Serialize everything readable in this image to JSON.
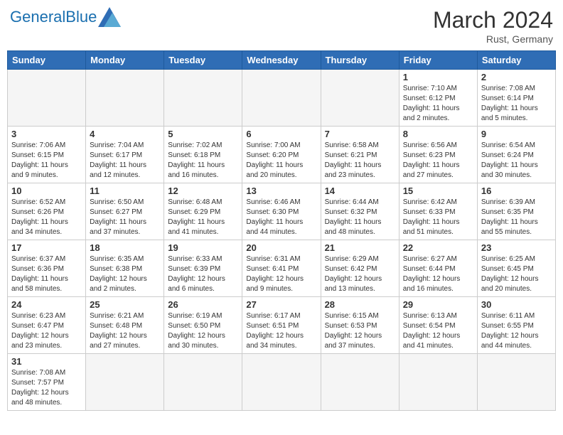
{
  "header": {
    "logo_general": "General",
    "logo_blue": "Blue",
    "month_title": "March 2024",
    "location": "Rust, Germany"
  },
  "weekdays": [
    "Sunday",
    "Monday",
    "Tuesday",
    "Wednesday",
    "Thursday",
    "Friday",
    "Saturday"
  ],
  "weeks": [
    [
      {
        "day": "",
        "info": ""
      },
      {
        "day": "",
        "info": ""
      },
      {
        "day": "",
        "info": ""
      },
      {
        "day": "",
        "info": ""
      },
      {
        "day": "",
        "info": ""
      },
      {
        "day": "1",
        "info": "Sunrise: 7:10 AM\nSunset: 6:12 PM\nDaylight: 11 hours\nand 2 minutes."
      },
      {
        "day": "2",
        "info": "Sunrise: 7:08 AM\nSunset: 6:14 PM\nDaylight: 11 hours\nand 5 minutes."
      }
    ],
    [
      {
        "day": "3",
        "info": "Sunrise: 7:06 AM\nSunset: 6:15 PM\nDaylight: 11 hours\nand 9 minutes."
      },
      {
        "day": "4",
        "info": "Sunrise: 7:04 AM\nSunset: 6:17 PM\nDaylight: 11 hours\nand 12 minutes."
      },
      {
        "day": "5",
        "info": "Sunrise: 7:02 AM\nSunset: 6:18 PM\nDaylight: 11 hours\nand 16 minutes."
      },
      {
        "day": "6",
        "info": "Sunrise: 7:00 AM\nSunset: 6:20 PM\nDaylight: 11 hours\nand 20 minutes."
      },
      {
        "day": "7",
        "info": "Sunrise: 6:58 AM\nSunset: 6:21 PM\nDaylight: 11 hours\nand 23 minutes."
      },
      {
        "day": "8",
        "info": "Sunrise: 6:56 AM\nSunset: 6:23 PM\nDaylight: 11 hours\nand 27 minutes."
      },
      {
        "day": "9",
        "info": "Sunrise: 6:54 AM\nSunset: 6:24 PM\nDaylight: 11 hours\nand 30 minutes."
      }
    ],
    [
      {
        "day": "10",
        "info": "Sunrise: 6:52 AM\nSunset: 6:26 PM\nDaylight: 11 hours\nand 34 minutes."
      },
      {
        "day": "11",
        "info": "Sunrise: 6:50 AM\nSunset: 6:27 PM\nDaylight: 11 hours\nand 37 minutes."
      },
      {
        "day": "12",
        "info": "Sunrise: 6:48 AM\nSunset: 6:29 PM\nDaylight: 11 hours\nand 41 minutes."
      },
      {
        "day": "13",
        "info": "Sunrise: 6:46 AM\nSunset: 6:30 PM\nDaylight: 11 hours\nand 44 minutes."
      },
      {
        "day": "14",
        "info": "Sunrise: 6:44 AM\nSunset: 6:32 PM\nDaylight: 11 hours\nand 48 minutes."
      },
      {
        "day": "15",
        "info": "Sunrise: 6:42 AM\nSunset: 6:33 PM\nDaylight: 11 hours\nand 51 minutes."
      },
      {
        "day": "16",
        "info": "Sunrise: 6:39 AM\nSunset: 6:35 PM\nDaylight: 11 hours\nand 55 minutes."
      }
    ],
    [
      {
        "day": "17",
        "info": "Sunrise: 6:37 AM\nSunset: 6:36 PM\nDaylight: 11 hours\nand 58 minutes."
      },
      {
        "day": "18",
        "info": "Sunrise: 6:35 AM\nSunset: 6:38 PM\nDaylight: 12 hours\nand 2 minutes."
      },
      {
        "day": "19",
        "info": "Sunrise: 6:33 AM\nSunset: 6:39 PM\nDaylight: 12 hours\nand 6 minutes."
      },
      {
        "day": "20",
        "info": "Sunrise: 6:31 AM\nSunset: 6:41 PM\nDaylight: 12 hours\nand 9 minutes."
      },
      {
        "day": "21",
        "info": "Sunrise: 6:29 AM\nSunset: 6:42 PM\nDaylight: 12 hours\nand 13 minutes."
      },
      {
        "day": "22",
        "info": "Sunrise: 6:27 AM\nSunset: 6:44 PM\nDaylight: 12 hours\nand 16 minutes."
      },
      {
        "day": "23",
        "info": "Sunrise: 6:25 AM\nSunset: 6:45 PM\nDaylight: 12 hours\nand 20 minutes."
      }
    ],
    [
      {
        "day": "24",
        "info": "Sunrise: 6:23 AM\nSunset: 6:47 PM\nDaylight: 12 hours\nand 23 minutes."
      },
      {
        "day": "25",
        "info": "Sunrise: 6:21 AM\nSunset: 6:48 PM\nDaylight: 12 hours\nand 27 minutes."
      },
      {
        "day": "26",
        "info": "Sunrise: 6:19 AM\nSunset: 6:50 PM\nDaylight: 12 hours\nand 30 minutes."
      },
      {
        "day": "27",
        "info": "Sunrise: 6:17 AM\nSunset: 6:51 PM\nDaylight: 12 hours\nand 34 minutes."
      },
      {
        "day": "28",
        "info": "Sunrise: 6:15 AM\nSunset: 6:53 PM\nDaylight: 12 hours\nand 37 minutes."
      },
      {
        "day": "29",
        "info": "Sunrise: 6:13 AM\nSunset: 6:54 PM\nDaylight: 12 hours\nand 41 minutes."
      },
      {
        "day": "30",
        "info": "Sunrise: 6:11 AM\nSunset: 6:55 PM\nDaylight: 12 hours\nand 44 minutes."
      }
    ],
    [
      {
        "day": "31",
        "info": "Sunrise: 7:08 AM\nSunset: 7:57 PM\nDaylight: 12 hours\nand 48 minutes."
      },
      {
        "day": "",
        "info": ""
      },
      {
        "day": "",
        "info": ""
      },
      {
        "day": "",
        "info": ""
      },
      {
        "day": "",
        "info": ""
      },
      {
        "day": "",
        "info": ""
      },
      {
        "day": "",
        "info": ""
      }
    ]
  ]
}
